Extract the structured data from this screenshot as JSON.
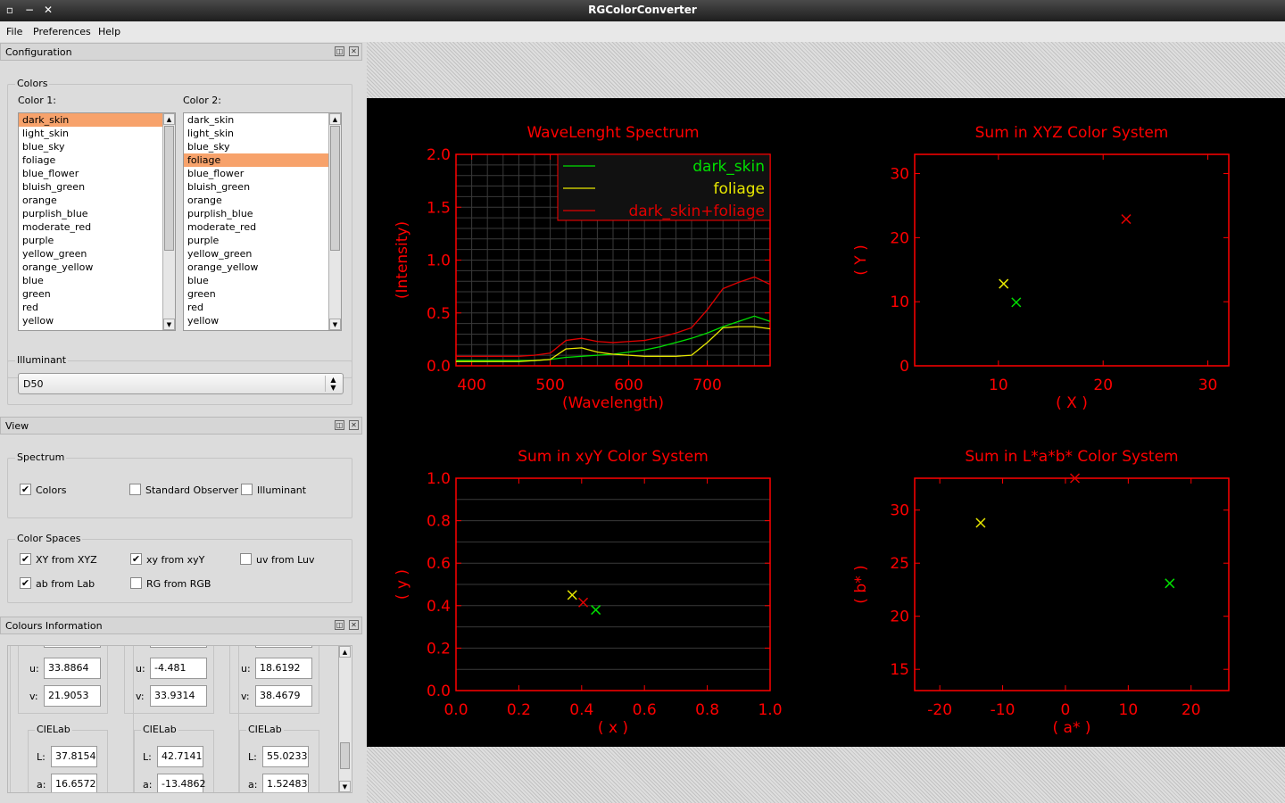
{
  "window": {
    "title": "RGColorConverter"
  },
  "menu": [
    "File",
    "Preferences",
    "Help"
  ],
  "config": {
    "title": "Configuration",
    "colors_group": "Colors",
    "color1_label": "Color 1:",
    "color2_label": "Color 2:",
    "items": [
      "dark_skin",
      "light_skin",
      "blue_sky",
      "foliage",
      "blue_flower",
      "bluish_green",
      "orange",
      "purplish_blue",
      "moderate_red",
      "purple",
      "yellow_green",
      "orange_yellow",
      "blue",
      "green",
      "red",
      "yellow"
    ],
    "color1_selected": 0,
    "color2_selected": 3,
    "illuminant_group": "Illuminant",
    "illuminant_value": "D50"
  },
  "view": {
    "title": "View",
    "spectrum_group": "Spectrum",
    "spectrum_opts": [
      {
        "label": "Colors",
        "checked": true
      },
      {
        "label": "Standard Observer",
        "checked": false
      },
      {
        "label": "Illuminant",
        "checked": false
      }
    ],
    "spaces_group": "Color Spaces",
    "space_opts": [
      {
        "label": "XY from XYZ",
        "checked": true
      },
      {
        "label": "xy from xyY",
        "checked": true
      },
      {
        "label": "uv from Luv",
        "checked": false
      },
      {
        "label": "ab from Lab",
        "checked": true
      },
      {
        "label": "RG from RGB",
        "checked": false
      }
    ]
  },
  "info": {
    "title": "Colours Information",
    "cols": [
      {
        "u": "33.8864",
        "v": "21.9053",
        "group": "CIELab",
        "L": "37.8154",
        "a": "16.6572"
      },
      {
        "u": "-4.481",
        "v": "33.9314",
        "group": "CIELab",
        "L": "42.7141",
        "a": "-13.4862"
      },
      {
        "u": "18.6192",
        "v": "38.4679",
        "group": "CIELab",
        "L": "55.0233",
        "a": "1.52483"
      }
    ],
    "u_label": "u:",
    "v_label": "v:",
    "L_label": "L:",
    "a_label": "a:"
  },
  "colors": {
    "axis": "#ff0000",
    "grid": "#3a3a3a",
    "dark_skin": "#00e000",
    "foliage": "#e8e800",
    "sum": "#e00000"
  },
  "chart_data": [
    {
      "type": "line",
      "title": "WaveLenght Spectrum",
      "xlabel": "(Wavelength)",
      "ylabel": "(Intensity)",
      "xlim": [
        380,
        780
      ],
      "ylim": [
        0,
        2
      ],
      "xticks": [
        "400",
        "500",
        "600",
        "700"
      ],
      "yticks": [
        "0.0",
        "0.5",
        "1.0",
        "1.5",
        "2.0"
      ],
      "legend": "top-right",
      "grid": true,
      "series": [
        {
          "name": "dark_skin",
          "color": "#00e000",
          "x": [
            380,
            400,
            420,
            440,
            460,
            480,
            500,
            520,
            540,
            560,
            580,
            600,
            620,
            640,
            660,
            680,
            700,
            720,
            740,
            760,
            780
          ],
          "y": [
            0.05,
            0.05,
            0.05,
            0.05,
            0.05,
            0.05,
            0.06,
            0.08,
            0.09,
            0.1,
            0.11,
            0.13,
            0.15,
            0.18,
            0.22,
            0.26,
            0.31,
            0.37,
            0.42,
            0.47,
            0.42
          ]
        },
        {
          "name": "foliage",
          "color": "#e8e800",
          "x": [
            380,
            400,
            420,
            440,
            460,
            480,
            500,
            520,
            540,
            560,
            580,
            600,
            620,
            640,
            660,
            680,
            700,
            720,
            740,
            760,
            780
          ],
          "y": [
            0.04,
            0.04,
            0.04,
            0.04,
            0.04,
            0.05,
            0.06,
            0.16,
            0.17,
            0.13,
            0.11,
            0.1,
            0.09,
            0.09,
            0.09,
            0.1,
            0.22,
            0.36,
            0.37,
            0.37,
            0.35
          ]
        },
        {
          "name": "dark_skin+foliage",
          "color": "#e00000",
          "x": [
            380,
            400,
            420,
            440,
            460,
            480,
            500,
            520,
            540,
            560,
            580,
            600,
            620,
            640,
            660,
            680,
            700,
            720,
            740,
            760,
            780
          ],
          "y": [
            0.09,
            0.09,
            0.09,
            0.09,
            0.09,
            0.1,
            0.12,
            0.24,
            0.26,
            0.23,
            0.22,
            0.23,
            0.24,
            0.27,
            0.31,
            0.36,
            0.53,
            0.73,
            0.79,
            0.84,
            0.77
          ]
        }
      ]
    },
    {
      "type": "scatter",
      "title": "Sum in XYZ Color System",
      "xlabel": "( X )",
      "ylabel": "( Y )",
      "xlim": [
        2,
        32
      ],
      "ylim": [
        0,
        33
      ],
      "xticks": [
        "10",
        "20",
        "30"
      ],
      "yticks": [
        "0",
        "10",
        "20",
        "30"
      ],
      "points": [
        {
          "x": 10.5,
          "y": 12.8,
          "color": "#e8e800"
        },
        {
          "x": 11.7,
          "y": 9.9,
          "color": "#00e000"
        },
        {
          "x": 22.2,
          "y": 22.9,
          "color": "#e00000"
        }
      ]
    },
    {
      "type": "scatter",
      "title": "Sum in xyY Color System",
      "xlabel": "( x )",
      "ylabel": "( y )",
      "xlim": [
        0,
        1
      ],
      "ylim": [
        0,
        1
      ],
      "xticks": [
        "0.0",
        "0.2",
        "0.4",
        "0.6",
        "0.8",
        "1.0"
      ],
      "yticks": [
        "0.0",
        "0.2",
        "0.4",
        "0.6",
        "0.8",
        "1.0"
      ],
      "grid": true,
      "points": [
        {
          "x": 0.37,
          "y": 0.45,
          "color": "#e8e800"
        },
        {
          "x": 0.405,
          "y": 0.415,
          "color": "#e00000"
        },
        {
          "x": 0.445,
          "y": 0.38,
          "color": "#00e000"
        }
      ]
    },
    {
      "type": "scatter",
      "title": "Sum in L*a*b* Color System",
      "xlabel": "( a* )",
      "ylabel": "( b* )",
      "xlim": [
        -24,
        26
      ],
      "ylim": [
        13,
        33
      ],
      "xticks": [
        "-20",
        "-10",
        "0",
        "10",
        "20"
      ],
      "yticks": [
        "15",
        "20",
        "25",
        "30"
      ],
      "points": [
        {
          "x": -13.5,
          "y": 28.8,
          "color": "#e8e800"
        },
        {
          "x": 16.6,
          "y": 23.1,
          "color": "#00e000"
        },
        {
          "x": 1.5,
          "y": 33.0,
          "color": "#e00000"
        }
      ]
    }
  ]
}
